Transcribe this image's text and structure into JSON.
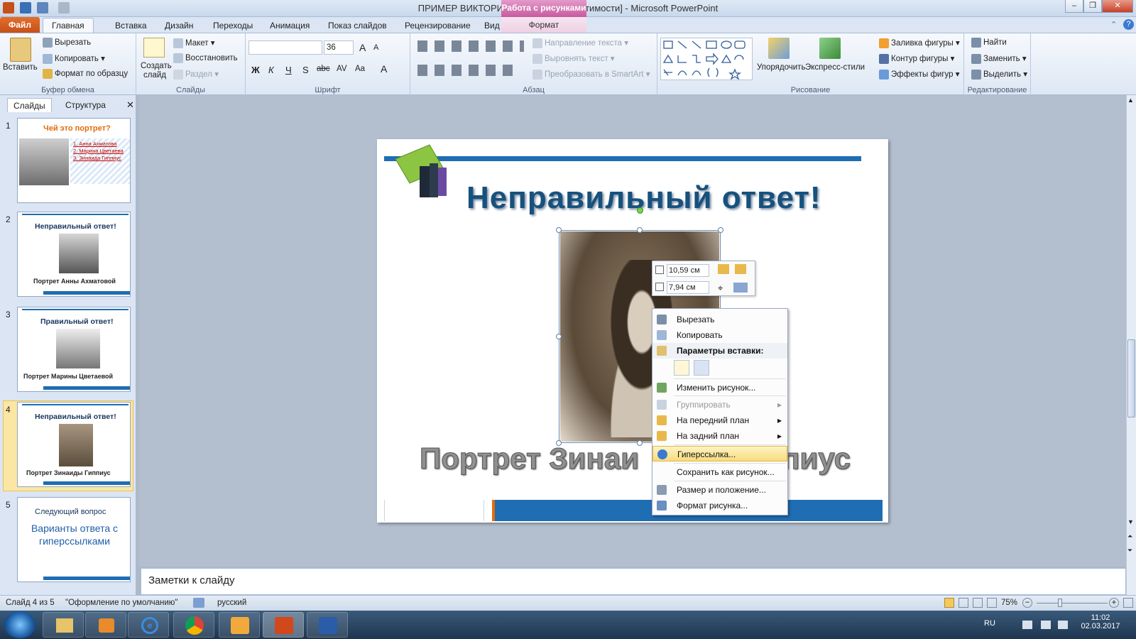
{
  "window": {
    "title": "ПРИМЕР ВИКТОРИНЫ [Режим совместимости]  -  Microsoft PowerPoint",
    "context_group": "Работа с рисунками",
    "context_tab": "Формат"
  },
  "tabs": [
    "Файл",
    "Главная",
    "Вставка",
    "Дизайн",
    "Переходы",
    "Анимация",
    "Показ слайдов",
    "Рецензирование",
    "Вид"
  ],
  "ribbon": {
    "clipboard": {
      "paste": "Вставить",
      "cut": "Вырезать",
      "copy": "Копировать",
      "format_painter": "Формат по образцу",
      "label": "Буфер обмена"
    },
    "slides": {
      "new_slide": "Создать слайд",
      "layout": "Макет",
      "reset": "Восстановить",
      "section": "Раздел",
      "label": "Слайды"
    },
    "font": {
      "font_size": "36",
      "bold": "Ж",
      "italic": "К",
      "underline": "Ч",
      "strike": "S",
      "abc": "abc",
      "spacing": "AV",
      "case": "Aa",
      "color": "A",
      "grow": "A",
      "shrink": "A",
      "label": "Шрифт"
    },
    "paragraph": {
      "text_direction": "Направление текста",
      "align_text": "Выровнять текст",
      "smartart": "Преобразовать в SmartArt",
      "label": "Абзац"
    },
    "drawing": {
      "arrange": "Упорядочить",
      "quick_styles": "Экспресс-стили",
      "fill": "Заливка фигуры",
      "outline": "Контур фигуры",
      "effects": "Эффекты фигур",
      "label": "Рисование"
    },
    "editing": {
      "find": "Найти",
      "replace": "Заменить",
      "select": "Выделить",
      "label": "Редактирование"
    }
  },
  "pane_tabs": [
    "Слайды",
    "Структура"
  ],
  "thumbnails": [
    {
      "num": "1",
      "title": "Чей это портрет?",
      "items": [
        "Анна Ахматова",
        "Марина Цветаева",
        "Зинаида Гиппиус"
      ]
    },
    {
      "num": "2",
      "title": "Неправильный ответ!",
      "caption": "Портрет Анны Ахматовой"
    },
    {
      "num": "3",
      "title": "Правильный ответ!",
      "caption": "Портрет Марины Цветаевой"
    },
    {
      "num": "4",
      "title": "Неправильный ответ!",
      "caption": "Портрет Зинаиды Гиппиус"
    },
    {
      "num": "5",
      "title": "Следующий вопрос",
      "caption": "Варианты ответа с гиперссылками"
    }
  ],
  "slide": {
    "title": "Неправильный ответ!",
    "caption": "Портрет Зинаи",
    "caption_tail": "пиус"
  },
  "mini_toolbar": {
    "height": "10,59 см",
    "width": "7,94 см"
  },
  "context_menu": {
    "cut": "Вырезать",
    "copy": "Копировать",
    "paste_options": "Параметры вставки:",
    "change_picture": "Изменить рисунок...",
    "group": "Группировать",
    "bring_front": "На передний план",
    "send_back": "На задний план",
    "hyperlink": "Гиперссылка...",
    "save_as_picture": "Сохранить как рисунок...",
    "size_position": "Размер и положение...",
    "format_picture": "Формат рисунка..."
  },
  "notes": "Заметки к слайду",
  "status": {
    "slide": "Слайд 4 из 5",
    "theme": "\"Оформление по умолчанию\"",
    "lang": "русский",
    "zoom": "75%"
  },
  "taskbar": {
    "lang": "RU",
    "time": "11:02",
    "date": "02.03.2017"
  }
}
